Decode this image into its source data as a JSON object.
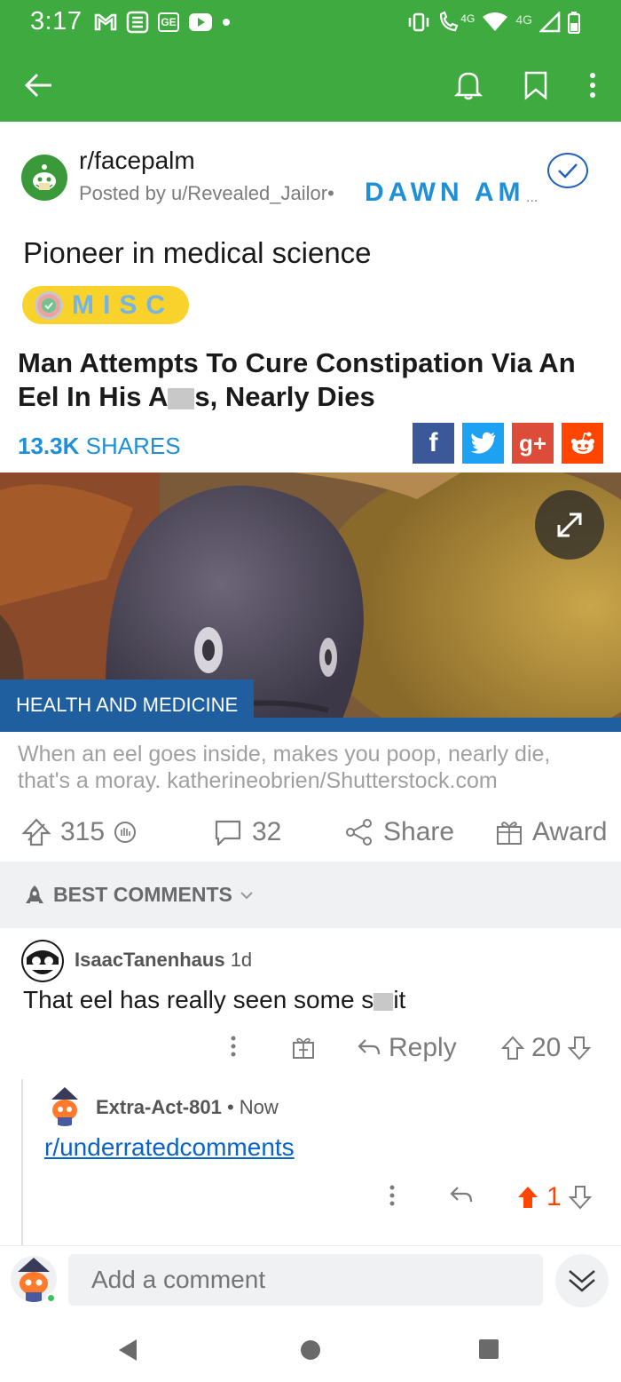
{
  "status_bar": {
    "time": "3:17",
    "left_icons": [
      "gmail-icon",
      "s-app-icon",
      "ge-icon",
      "youtube-icon",
      "dot-icon"
    ],
    "right_icons": [
      "vibrate-icon",
      "call-4g-icon",
      "wifi-icon",
      "signal-icon",
      "battery-icon"
    ],
    "network_label": "4G",
    "call_label": "4G"
  },
  "app_bar": {
    "back_icon": "arrow-left-icon",
    "actions": [
      "bell-icon",
      "bookmark-icon",
      "more-vertical-icon"
    ]
  },
  "post": {
    "subreddit": "r/facepalm",
    "posted_by": "Posted by u/Revealed_Jailor",
    "separator": "•",
    "user_flair": "DAWN AM",
    "user_flair_ellipsis": "...",
    "title": "Pioneer in medical science",
    "flair": "MISC",
    "article": {
      "headline_part1": "Man Attempts To Cure Constipation Via An Eel In His A",
      "headline_part2": "s, Nearly Dies",
      "shares_count": "13.3K",
      "shares_label": " SHARES",
      "social": [
        {
          "name": "facebook",
          "label": "f",
          "color": "#3b5998"
        },
        {
          "name": "twitter",
          "label": "",
          "color": "#1da1f2"
        },
        {
          "name": "googleplus",
          "label": "g+",
          "color": "#dd4b39"
        },
        {
          "name": "reddit",
          "label": "",
          "color": "#ff4500"
        }
      ],
      "category_tag": "HEALTH AND MEDICINE",
      "caption": "When an eel goes inside, makes you poop, nearly die, that's a moray. katherineobrien/Shutterstock.com"
    },
    "actions": {
      "votes": "315",
      "comments": "32",
      "share": "Share",
      "award": "Award"
    }
  },
  "comments_header": {
    "label": "BEST COMMENTS"
  },
  "comments": [
    {
      "author": "IsaacTanenhaus",
      "age": "1d",
      "body_part1": "That eel has really seen some s",
      "body_part2": "it",
      "reply_label": "Reply",
      "score": "20"
    },
    {
      "author": "Extra-Act-801",
      "age": "Now",
      "separator": "•",
      "link": "r/underratedcomments",
      "score": "1"
    }
  ],
  "comment_bar": {
    "placeholder": "Add a comment"
  },
  "colors": {
    "app_green": "#3faa3f",
    "link_blue": "#0a63c9",
    "share_blue": "#1e90d8",
    "upvote_orange": "#ff4500",
    "flair_yellow": "#f9d32b"
  }
}
